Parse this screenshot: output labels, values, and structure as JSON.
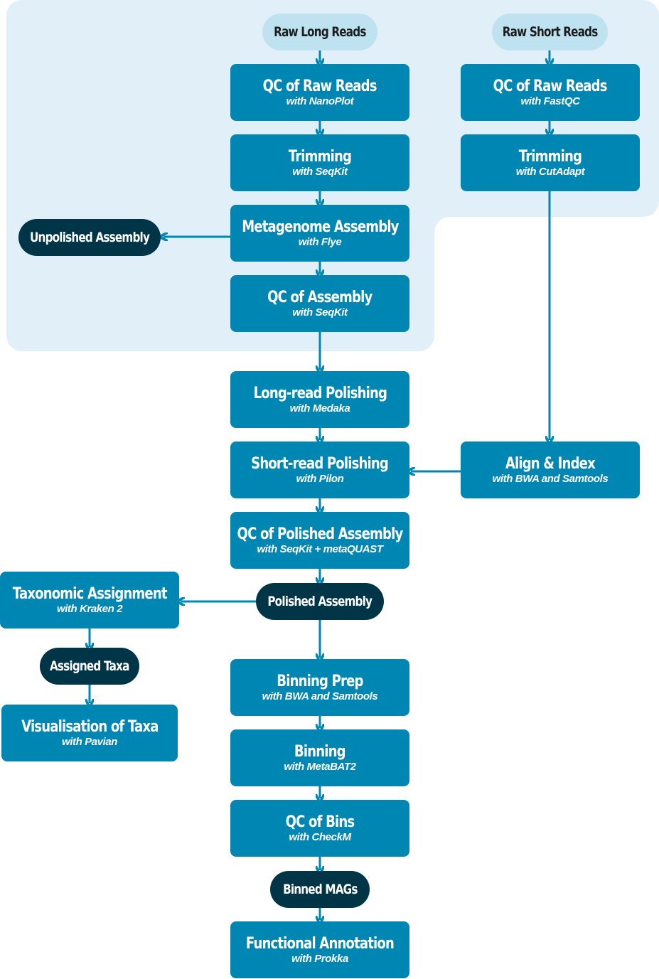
{
  "colors": {
    "process": "#0086b3",
    "input": "#bfe2f0",
    "output": "#003548",
    "panel": "#e1f0f8",
    "edge": "#0086b3"
  },
  "inputs": {
    "long_reads": "Raw Long Reads",
    "short_reads": "Raw Short Reads"
  },
  "steps": {
    "qc_long": {
      "title": "QC of Raw Reads",
      "tool": "with NanoPlot"
    },
    "trim_long": {
      "title": "Trimming",
      "tool": "with SeqKit"
    },
    "assembly": {
      "title": "Metagenome Assembly",
      "tool": "with Flye"
    },
    "qc_assembly": {
      "title": "QC of Assembly",
      "tool": "with SeqKit"
    },
    "qc_short": {
      "title": "QC of Raw Reads",
      "tool": "with FastQC"
    },
    "trim_short": {
      "title": "Trimming",
      "tool": "with CutAdapt"
    },
    "long_polish": {
      "title": "Long-read Polishing",
      "tool": "with Medaka"
    },
    "short_polish": {
      "title": "Short-read Polishing",
      "tool": "with Pilon"
    },
    "align_index": {
      "title": "Align & Index",
      "tool": "with BWA and Samtools"
    },
    "qc_polished": {
      "title": "QC of Polished Assembly",
      "tool": "with SeqKit + metaQUAST"
    },
    "taxonomy": {
      "title": "Taxonomic Assignment",
      "tool": "with Kraken 2"
    },
    "visual_taxa": {
      "title": "Visualisation of Taxa",
      "tool": "with Pavian"
    },
    "binning_prep": {
      "title": "Binning Prep",
      "tool": "with BWA and Samtools"
    },
    "binning": {
      "title": "Binning",
      "tool": "with MetaBAT2"
    },
    "qc_bins": {
      "title": "QC of Bins",
      "tool": "with CheckM"
    },
    "functional": {
      "title": "Functional Annotation",
      "tool": "with Prokka"
    }
  },
  "outputs": {
    "unpolished": "Unpolished Assembly",
    "polished": "Polished Assembly",
    "assigned_taxa": "Assigned Taxa",
    "binned_mags": "Binned MAGs"
  }
}
